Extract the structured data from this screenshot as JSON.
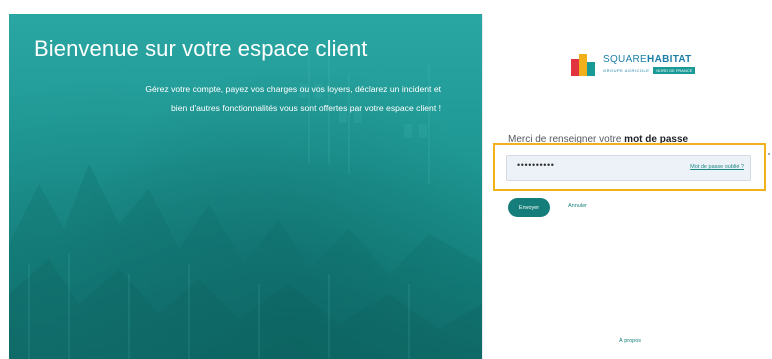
{
  "hero": {
    "title": "Bienvenue sur votre espace client",
    "line1": "Gérez votre compte, payez vos charges ou vos loyers, déclarez un incident et",
    "line2": "bien d'autres fonctionnalités vous sont offertes par votre espace client !"
  },
  "logo": {
    "name_light": "SQUARE",
    "name_bold": "HABITAT",
    "subtitle_left": "GROUPE AGRICOLE",
    "subtitle_right": "NORD DE FRANCE"
  },
  "form": {
    "prompt_prefix": "Merci de renseigner votre ",
    "prompt_bold": "mot de passe",
    "password_value": "••••••••••",
    "forgot_label": "Mot de passe oublié ?",
    "submit_label": "Envoyer",
    "cancel_label": "Annuler"
  },
  "footer": {
    "about_label": "À propos"
  },
  "colors": {
    "teal": "#1f9894",
    "button": "#157e7a",
    "highlight": "#f2b11b",
    "field_bg": "#edf1f8"
  }
}
